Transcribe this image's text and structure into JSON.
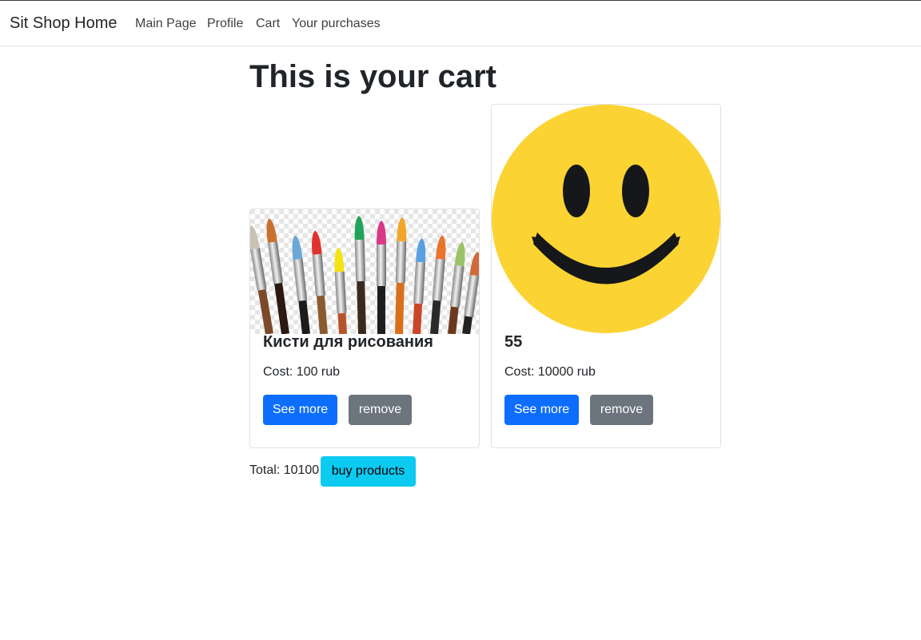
{
  "navbar": {
    "brand": "Sit Shop Home",
    "links": [
      "Main Page",
      "Profile",
      "Cart",
      "Your purchases"
    ]
  },
  "page": {
    "title": "This is your cart"
  },
  "cart": {
    "items": [
      {
        "title": "Кисти для рисования",
        "cost": "Cost: 100 rub",
        "image_icon": "paint-brushes-image",
        "see_more_label": "See more",
        "remove_label": "remove"
      },
      {
        "title": "55",
        "cost": "Cost: 10000 rub",
        "image_icon": "smiley-face-image",
        "see_more_label": "See more",
        "remove_label": "remove"
      }
    ],
    "total": "Total: 10100",
    "buy_label": "buy products"
  },
  "colors": {
    "primary": "#0d6efd",
    "secondary": "#6c757d",
    "info": "#0dcaf0",
    "smiley_yellow": "#fbd433"
  }
}
